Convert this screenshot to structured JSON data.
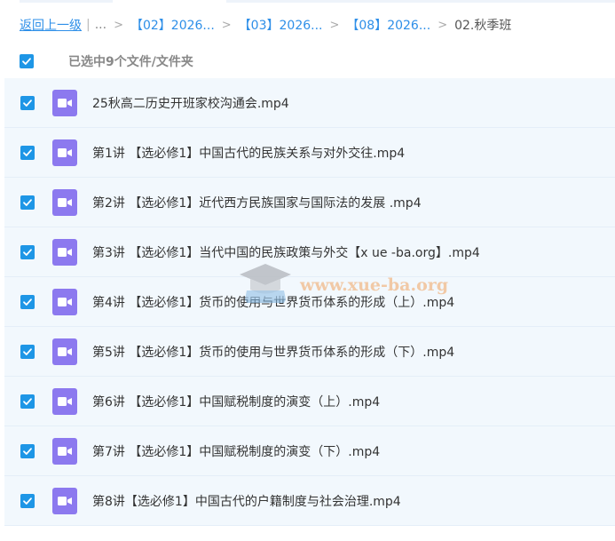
{
  "breadcrumb": {
    "back_label": "返回上一级",
    "separator": "|",
    "ellipsis": "...",
    "arrow": ">",
    "crumbs": [
      "【02】2026...",
      "【03】2026...",
      "【08】2026..."
    ],
    "current": "02.秋季班"
  },
  "selection": {
    "label": "已选中9个文件/文件夹"
  },
  "files": [
    {
      "name": "25秋高二历史开班家校沟通会.mp4",
      "checked": true,
      "icon": "video-file-icon"
    },
    {
      "name": "第1讲 【选必修1】中国古代的民族关系与对外交往.mp4",
      "checked": true,
      "icon": "video-file-icon"
    },
    {
      "name": "第2讲 【选必修1】近代西方民族国家与国际法的发展 .mp4",
      "checked": true,
      "icon": "video-file-icon"
    },
    {
      "name": "第3讲 【选必修1】当代中国的民族政策与外交【x ue -ba.org】.mp4",
      "checked": true,
      "icon": "video-file-icon"
    },
    {
      "name": "第4讲 【选必修1】货币的使用与世界货币体系的形成（上）.mp4",
      "checked": true,
      "icon": "video-file-icon"
    },
    {
      "name": "第5讲 【选必修1】货币的使用与世界货币体系的形成（下）.mp4",
      "checked": true,
      "icon": "video-file-icon"
    },
    {
      "name": "第6讲 【选必修1】中国赋税制度的演变（上）.mp4",
      "checked": true,
      "icon": "video-file-icon"
    },
    {
      "name": "第7讲 【选必修1】中国赋税制度的演变（下）.mp4",
      "checked": true,
      "icon": "video-file-icon"
    },
    {
      "name": "第8讲【选必修1】中国古代的户籍制度与社会治理.mp4",
      "checked": true,
      "icon": "video-file-icon"
    }
  ],
  "watermark": {
    "text": "www.xue-ba.org"
  },
  "colors": {
    "accent": "#1e96e6",
    "link": "#2e8fe8",
    "file_icon": "#8c79ef",
    "row_bg": "#f2f8fd"
  }
}
